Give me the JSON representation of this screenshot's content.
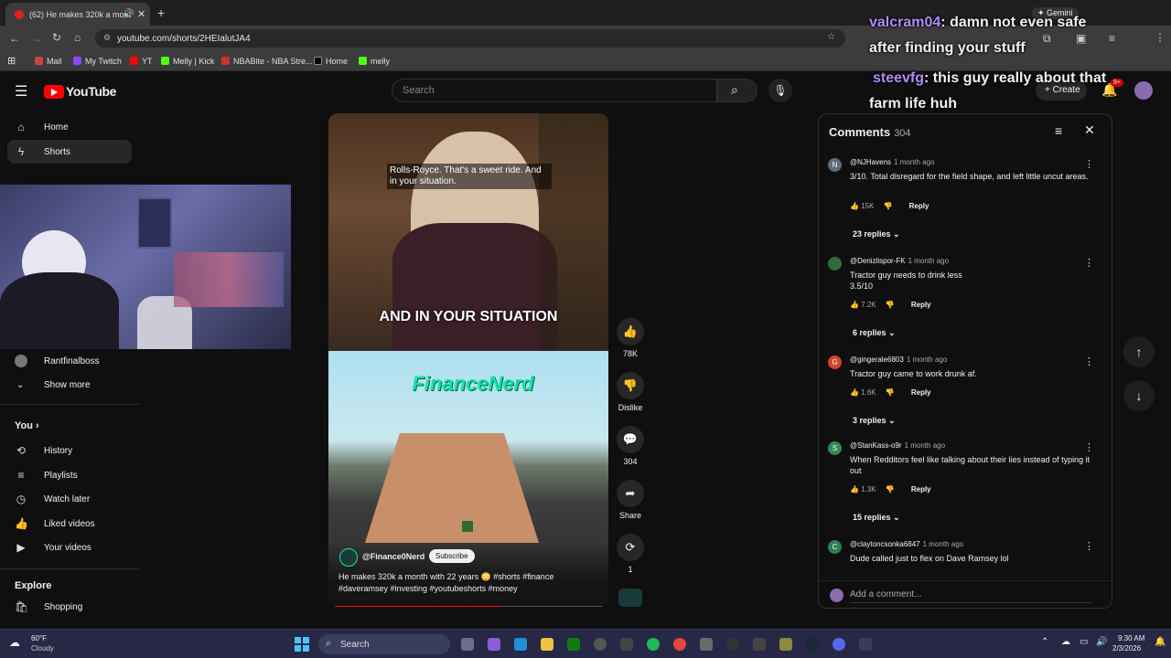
{
  "browser": {
    "tab_title": "(62) He makes 320k a mont",
    "url": "youtube.com/shorts/2HEIalutJA4",
    "bookmarks": [
      "Mail",
      "My Twitch",
      "YT",
      "Melly | Kick",
      "NBABite - NBA Stre...",
      "Home",
      "melly"
    ],
    "gemini_label": "Gemini"
  },
  "header": {
    "logo": "YouTube",
    "search_placeholder": "Search",
    "create_label": "Create",
    "notif_badge": "9+"
  },
  "sidebar": {
    "home": "Home",
    "shorts": "Shorts",
    "channel": "Rantfinalboss",
    "show_more": "Show more",
    "you": "You",
    "history": "History",
    "playlists": "Playlists",
    "watch_later": "Watch later",
    "liked": "Liked videos",
    "your_videos": "Your videos",
    "explore": "Explore",
    "shopping": "Shopping"
  },
  "video": {
    "caption_top": "Rolls-Royce. That's a sweet ride. And in your situation.",
    "caption_big": "AND IN YOUR SITUATION",
    "brand": "FinanceNerd",
    "channel": "@Finance0Nerd",
    "subscribe": "Subscribe",
    "description": "He makes 320k a month with 22 years 😳 #shorts #finance #daveramsey #investing #youtubeshorts #money",
    "progress": 0.62
  },
  "actions": {
    "likes": "78K",
    "dislike": "Dislike",
    "comments": "304",
    "share": "Share",
    "remix": "1"
  },
  "comments": {
    "title": "Comments",
    "count": "304",
    "add_placeholder": "Add a comment...",
    "reply_label": "Reply",
    "items": [
      {
        "initial": "N",
        "color": "#5f6c7b",
        "author": "@NJHavens",
        "time": "1 month ago",
        "text": "3/10. Total disregard for the field shape, and left little uncut areas.",
        "likes": "15K",
        "replies": "23 replies"
      },
      {
        "initial": "",
        "color": "#2f6b3a",
        "author": "@Denizlispor-FK",
        "time": "1 month ago",
        "text": "Tractor guy needs to drink less\n3.5/10",
        "likes": "7.2K",
        "replies": "6 replies"
      },
      {
        "initial": "G",
        "color": "#d0452a",
        "author": "@gingerale6803",
        "time": "1 month ago",
        "text": "Tractor guy came to work drunk af.",
        "likes": "1.6K",
        "replies": "3 replies"
      },
      {
        "initial": "S",
        "color": "#2e8b57",
        "author": "@StanKass-o9r",
        "time": "1 month ago",
        "text": "When Redditors feel like talking about their lies instead of typing it out",
        "likes": "1.3K",
        "replies": "15 replies"
      },
      {
        "initial": "C",
        "color": "#2e7d4f",
        "author": "@claytoncsonka6847",
        "time": "1 month ago",
        "text": "Dude called just to flex on Dave Ramsey lol",
        "likes": "",
        "replies": ""
      }
    ]
  },
  "chat": [
    {
      "user": "valcram04",
      "message": ": damn not even safe",
      "cont": "after finding your stuff"
    },
    {
      "user": "steevfg",
      "message": ": this guy really about that",
      "cont": "farm life huh"
    }
  ],
  "taskbar": {
    "weather_temp": "60°F",
    "weather_desc": "Cloudy",
    "search": "Search",
    "time": "9:30 AM",
    "date": "2/3/2026"
  }
}
